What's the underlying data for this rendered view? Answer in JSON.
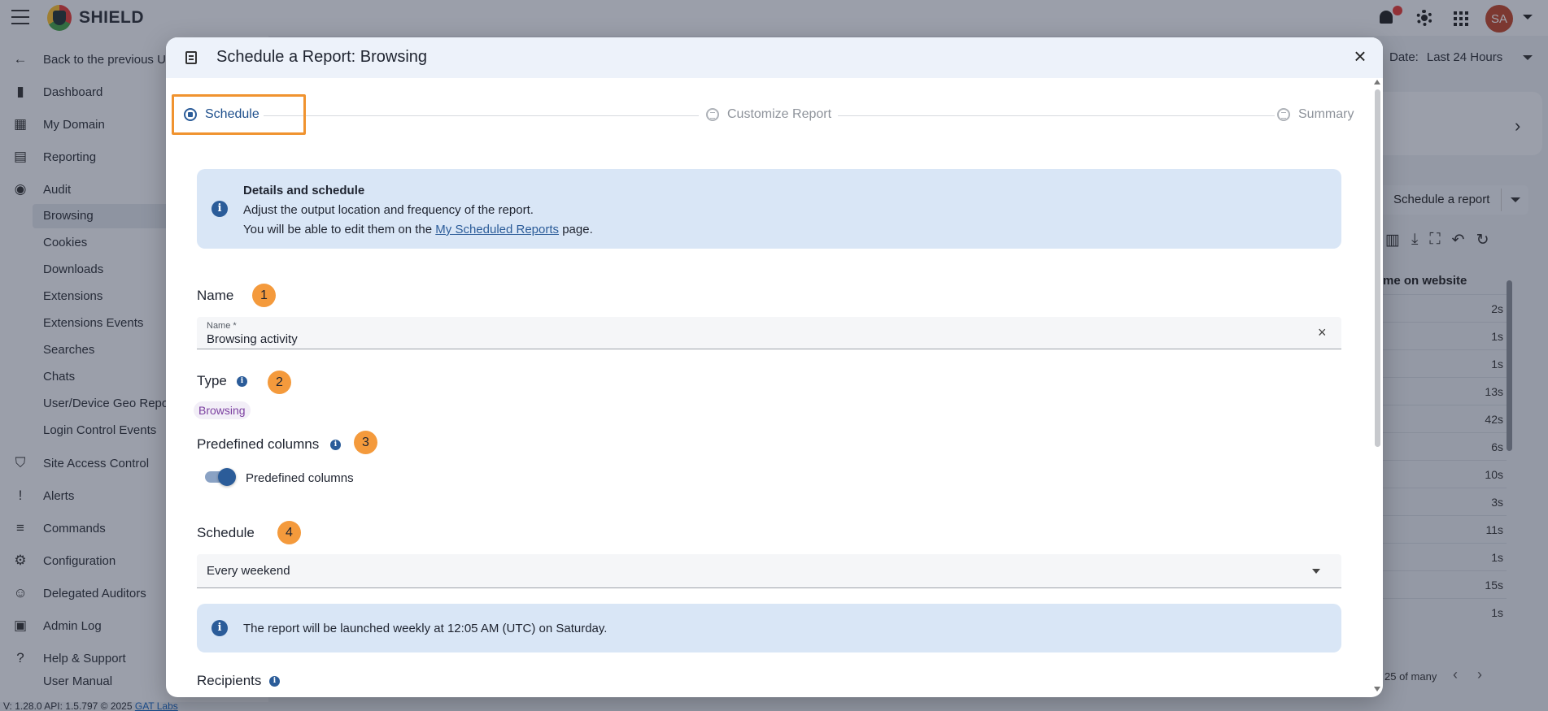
{
  "app": {
    "brand": "SHIELD",
    "avatar_initials": "SA",
    "date_label": "Date:",
    "date_value": "Last 24 Hours"
  },
  "sidebar": {
    "items": [
      {
        "label": "Back to the previous U",
        "icon": "arrow-left-icon"
      },
      {
        "label": "Dashboard",
        "icon": "bar-chart-icon"
      },
      {
        "label": "My Domain",
        "icon": "building-icon"
      },
      {
        "label": "Reporting",
        "icon": "clipboard-icon"
      },
      {
        "label": "Audit",
        "icon": "shield-search-icon"
      }
    ],
    "audit_sub": [
      "Browsing",
      "Cookies",
      "Downloads",
      "Extensions",
      "Extensions Events",
      "Searches",
      "Chats",
      "User/Device Geo Repor",
      "Login Control Events"
    ],
    "lower_items": [
      {
        "label": "Site Access Control",
        "icon": "shield-icon"
      },
      {
        "label": "Alerts",
        "icon": "alert-shield-icon"
      },
      {
        "label": "Commands",
        "icon": "commands-icon"
      },
      {
        "label": "Configuration",
        "icon": "gear-icon"
      },
      {
        "label": "Delegated Auditors",
        "icon": "group-icon"
      },
      {
        "label": "Admin Log",
        "icon": "log-icon"
      },
      {
        "label": "Help & Support",
        "icon": "help-icon"
      },
      {
        "label": "User Manual",
        "icon": "external-link-icon"
      }
    ],
    "footer_version": "V: 1.28.0   API: 1.5.797   © 2025",
    "footer_link": "GAT Labs"
  },
  "background_panel": {
    "schedule_button": "Schedule a report",
    "column_header": "me on website",
    "values": [
      "2s",
      "1s",
      "1s",
      "13s",
      "42s",
      "6s",
      "10s",
      "3s",
      "11s",
      "1s",
      "15s",
      "1s"
    ],
    "pager": "25 of many"
  },
  "dialog": {
    "title": "Schedule a Report: Browsing",
    "steps": [
      "Schedule",
      "Customize Report",
      "Summary"
    ],
    "details": {
      "title": "Details and schedule",
      "line1": "Adjust the output location and frequency of the report.",
      "line2_prefix": "You will be able to edit them on the ",
      "line2_link": "My Scheduled Reports",
      "line2_suffix": " page."
    },
    "name": {
      "label": "Name",
      "badge": "1",
      "field_label": "Name *",
      "value": "Browsing activity"
    },
    "type": {
      "label": "Type",
      "badge": "2",
      "chip": "Browsing"
    },
    "predefined": {
      "label": "Predefined columns",
      "badge": "3",
      "toggle_label": "Predefined columns",
      "enabled": true
    },
    "schedule": {
      "label": "Schedule",
      "badge": "4",
      "value": "Every weekend",
      "info": "The report will be launched weekly at 12:05 AM (UTC) on Saturday."
    },
    "recipients": {
      "label": "Recipients"
    }
  }
}
